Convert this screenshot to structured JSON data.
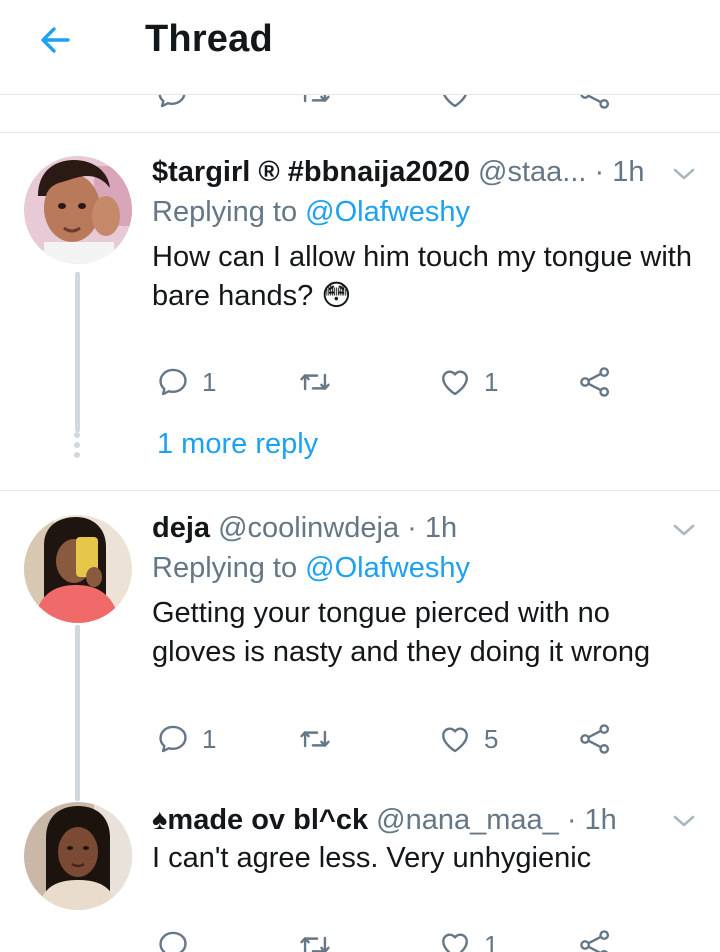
{
  "header": {
    "title": "Thread"
  },
  "tweets": [
    {
      "name": "$targirl ® #bbnaija2020",
      "handle": "@staa...",
      "time": "· 1h",
      "replying_prefix": "Replying to ",
      "replying_to": "@Olafweshy",
      "text": "How can I allow him touch my tongue with bare hands? 😳",
      "reply_count": "1",
      "retweet_count": "",
      "like_count": "1",
      "more_reply": "1 more reply"
    },
    {
      "name": "deja",
      "handle": "@coolinwdeja",
      "time": "· 1h",
      "replying_prefix": "Replying to ",
      "replying_to": "@Olafweshy",
      "text": "Getting your tongue pierced with no gloves is nasty and they doing it wrong",
      "reply_count": "1",
      "retweet_count": "",
      "like_count": "5"
    },
    {
      "name": "♠made ov bl^ck",
      "handle": "@nana_maa_",
      "time": "· 1h",
      "text": "I can't agree less. Very unhygienic",
      "reply_count": "",
      "retweet_count": "",
      "like_count": "1"
    }
  ],
  "colors": {
    "accent": "#1da1f2",
    "secondary_text": "#657786",
    "divider": "#e1e8ed"
  }
}
